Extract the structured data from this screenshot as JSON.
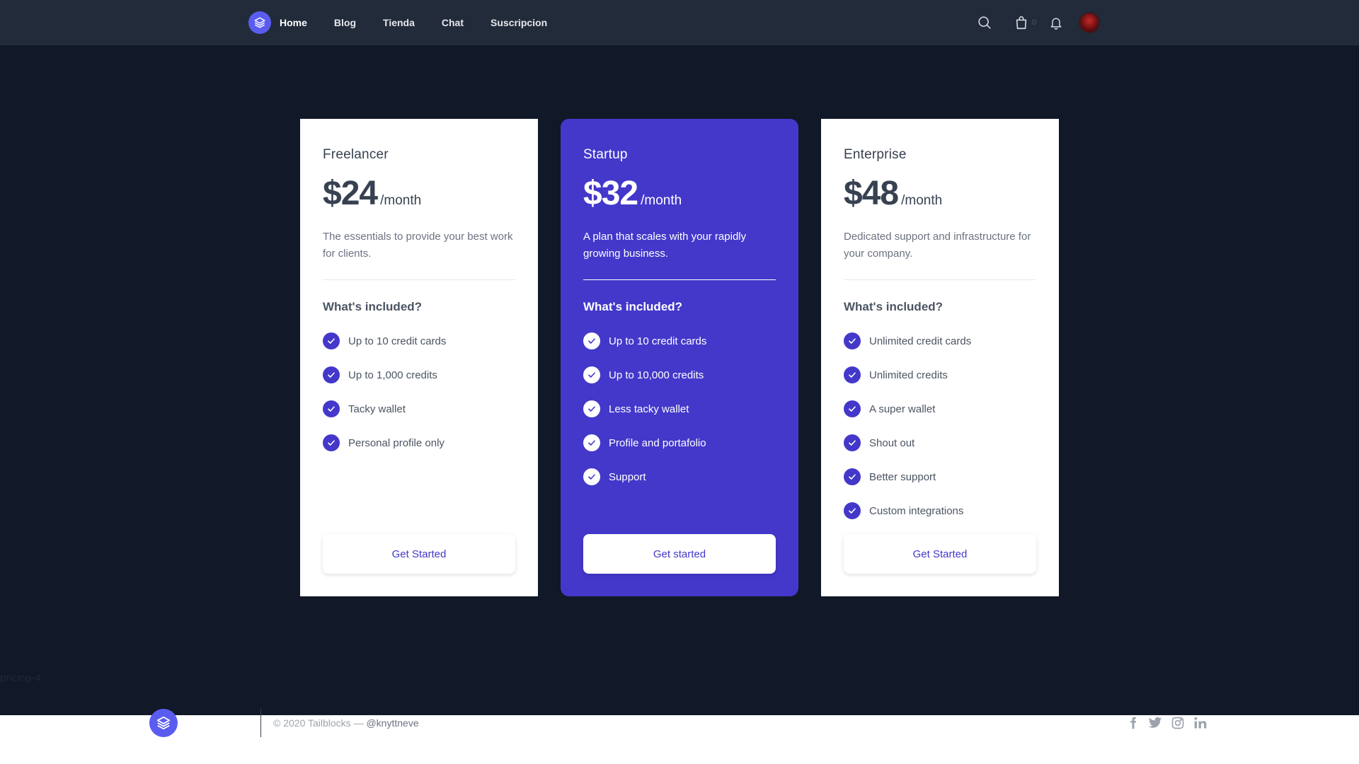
{
  "header": {
    "nav": [
      "Home",
      "Blog",
      "Tienda",
      "Chat",
      "Suscripcion"
    ],
    "cart_count": "0",
    "icons": [
      "search-icon",
      "shopping-bag-icon",
      "bell-icon",
      "avatar"
    ]
  },
  "pricing": {
    "included_heading": "What's included?",
    "plans": [
      {
        "name": "Freelancer",
        "price": "$24",
        "period": "/month",
        "description": "The essentials to provide your best work for clients.",
        "features": [
          "Up to 10 credit cards",
          "Up to 1,000 credits",
          "Tacky wallet",
          "Personal profile only"
        ],
        "cta": "Get Started"
      },
      {
        "name": "Startup",
        "price": "$32",
        "period": "/month",
        "description": "A plan that scales with your rapidly growing business.",
        "features": [
          "Up to 10 credit cards",
          "Up to 10,000 credits",
          "Less tacky wallet",
          "Profile and portafolio",
          "Support"
        ],
        "cta": "Get started"
      },
      {
        "name": "Enterprise",
        "price": "$48",
        "period": "/month",
        "description": "Dedicated support and infrastructure for your company.",
        "features": [
          "Unlimited credit cards",
          "Unlimited credits",
          "A super wallet",
          "Shout out",
          "Better support",
          "Custom integrations"
        ],
        "cta": "Get Started"
      }
    ]
  },
  "section_label": "pricing-4",
  "footer": {
    "brand": "Tailblocks",
    "copyright": "© 2020 Tailblocks —",
    "handle": "@knyttneve",
    "socials": [
      "facebook-icon",
      "twitter-icon",
      "instagram-icon",
      "linkedin-icon"
    ]
  },
  "colors": {
    "header_bg": "#222b3a",
    "page_bg": "#111827",
    "accent": "#4338ca",
    "logo": "#5a5cf0"
  }
}
